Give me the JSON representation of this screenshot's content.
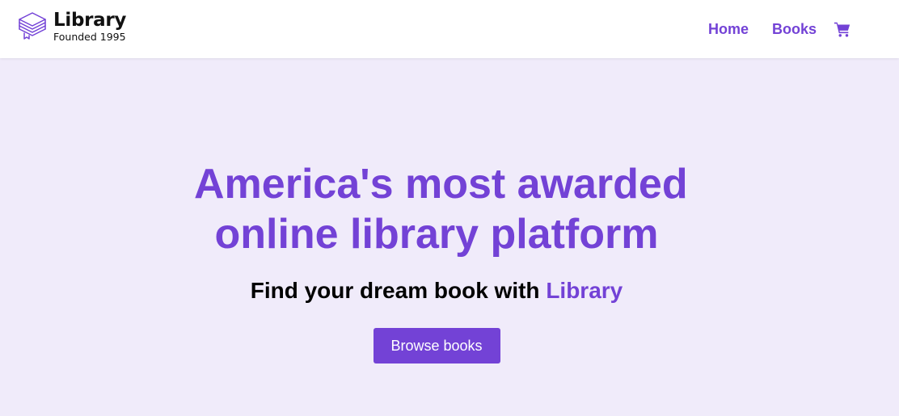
{
  "colors": {
    "accent": "#7342d6",
    "hero_background": "#f0ebfa",
    "nav_background": "#ffffff",
    "text": "#000000"
  },
  "header": {
    "logo": {
      "icon": "stacked-books-icon",
      "title": "Library",
      "subtitle": "Founded 1995"
    },
    "nav": {
      "home_label": "Home",
      "books_label": "Books",
      "cart_icon": "shopping-cart-icon"
    }
  },
  "hero": {
    "title_line1": "America's most awarded",
    "title_line2": "online library platform",
    "subtitle_text": "Find your dream book with ",
    "subtitle_brand": "Library",
    "button_label": "Browse books"
  }
}
